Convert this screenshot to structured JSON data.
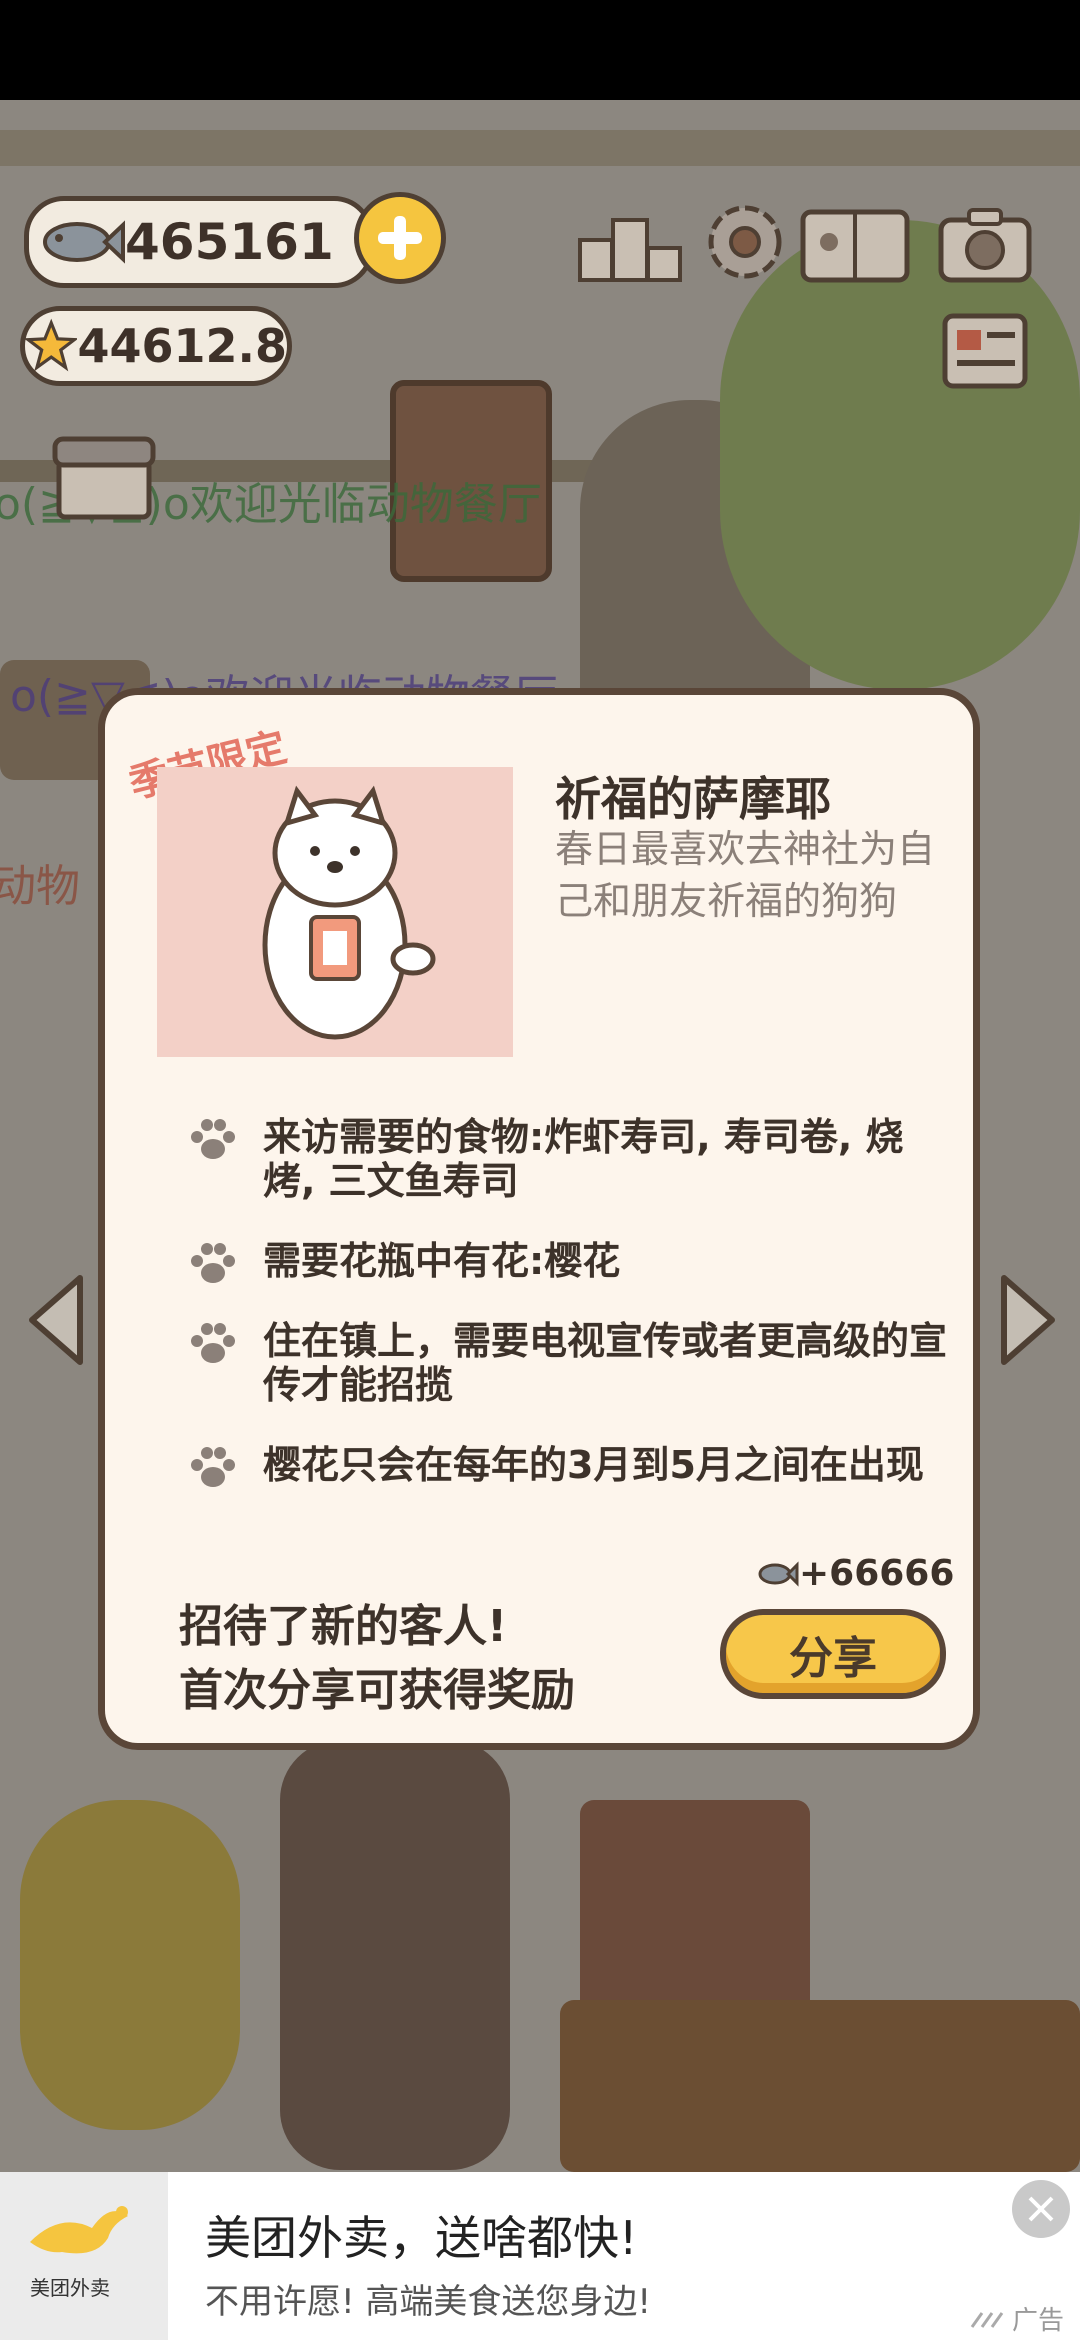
{
  "hud": {
    "fish_count": "465161",
    "star_count": "44612.8"
  },
  "scrolling_messages": {
    "line1": "o(≧▽≦)o欢迎光临动物餐厅",
    "line2": "o(≧▽≦)o欢迎光临动物餐厅",
    "line3": "动物"
  },
  "modal": {
    "seasonal_tag": "季节限定",
    "character_name": "祈福的萨摩耶",
    "character_desc": "春日最喜欢去神社为自己和朋友祈福的狗狗",
    "requirements": [
      "来访需要的食物:炸虾寿司, 寿司卷, 烧烤, 三文鱼寿司",
      "需要花瓶中有花:樱花",
      "住在镇上，需要电视宣传或者更高级的宣传才能招揽",
      "樱花只会在每年的3月到5月之间在出现"
    ],
    "reward": "+66666",
    "share_message_line1": "招待了新的客人!",
    "share_message_line2": "首次分享可获得奖励",
    "share_button": "分享"
  },
  "ad": {
    "brand": "美团外卖",
    "title": "美团外卖，送啥都快!",
    "subtitle": "不用许愿!  高端美食送您身边!",
    "ad_label": "广告"
  },
  "colors": {
    "modal_bg": "#fdf5ec",
    "accent_yellow": "#f7c74a",
    "seasonal_tag": "#e57a6b",
    "outline_brown": "#5a4638"
  }
}
